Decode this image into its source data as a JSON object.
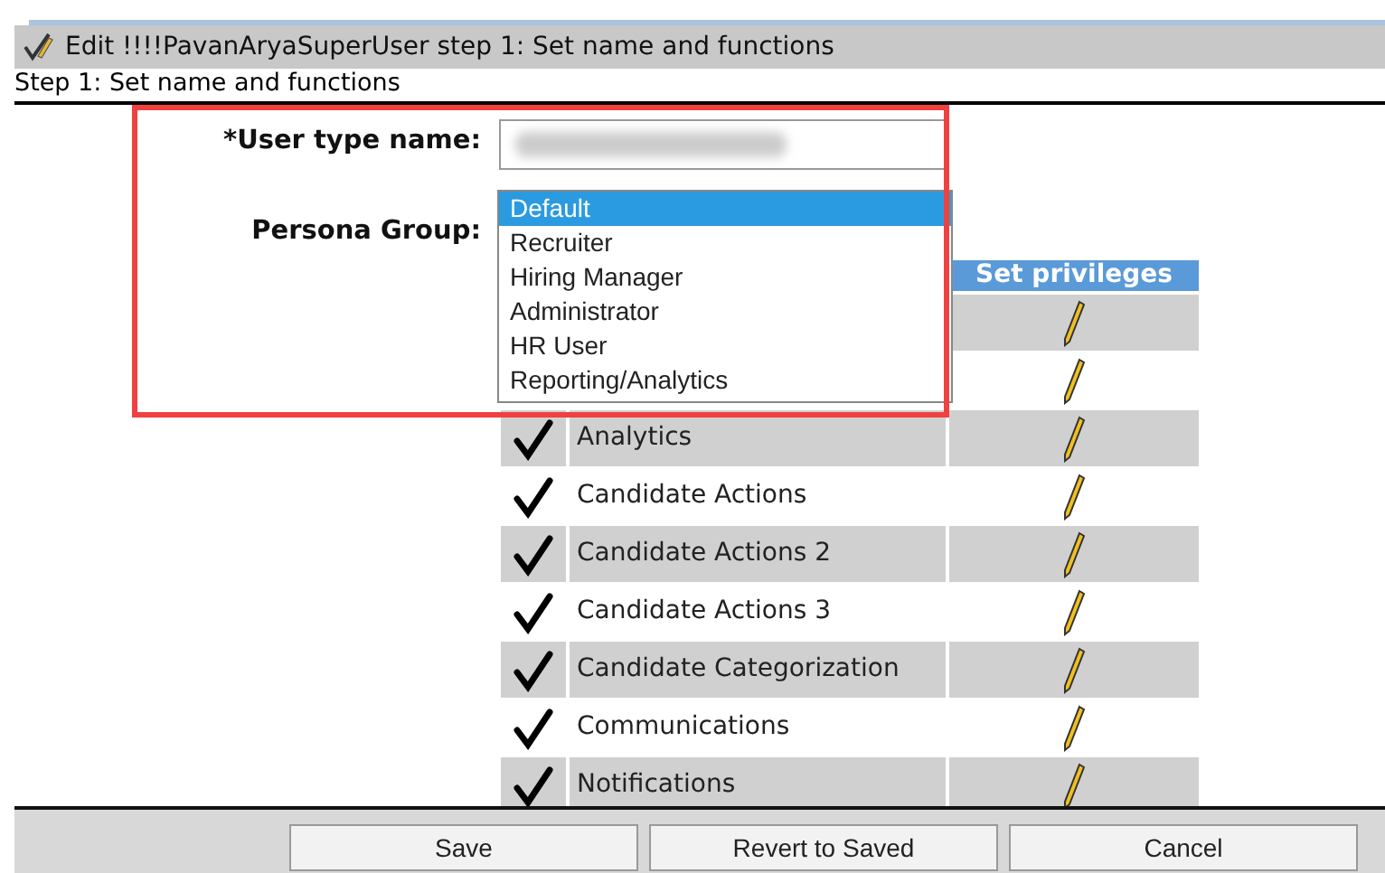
{
  "window": {
    "title": "Edit !!!!PavanAryaSuperUser step 1: Set name and functions"
  },
  "step_heading": "Step 1: Set name and functions",
  "form": {
    "user_type_name": {
      "label": "*User type name:",
      "blurred": true
    },
    "persona_group": {
      "label": "Persona Group:",
      "options": [
        {
          "label": "Default",
          "selected": true
        },
        {
          "label": "Recruiter",
          "selected": false
        },
        {
          "label": "Hiring Manager",
          "selected": false
        },
        {
          "label": "Administrator",
          "selected": false
        },
        {
          "label": "HR User",
          "selected": false
        },
        {
          "label": "Reporting/Analytics",
          "selected": false
        }
      ]
    }
  },
  "table": {
    "privileges_header": "Set privileges",
    "rows": [
      {
        "kind": "covered"
      },
      {
        "kind": "covered"
      },
      {
        "kind": "function",
        "name": "Analytics",
        "checked": true
      },
      {
        "kind": "function",
        "name": "Candidate Actions",
        "checked": true
      },
      {
        "kind": "function",
        "name": "Candidate Actions 2",
        "checked": true
      },
      {
        "kind": "function",
        "name": "Candidate Actions 3",
        "checked": true
      },
      {
        "kind": "function",
        "name": "Candidate Categorization",
        "checked": true
      },
      {
        "kind": "function",
        "name": "Communications",
        "checked": true
      },
      {
        "kind": "function",
        "name": "Notifications",
        "checked": true
      }
    ]
  },
  "buttons": [
    "Save",
    "Revert to Saved",
    "Cancel"
  ]
}
